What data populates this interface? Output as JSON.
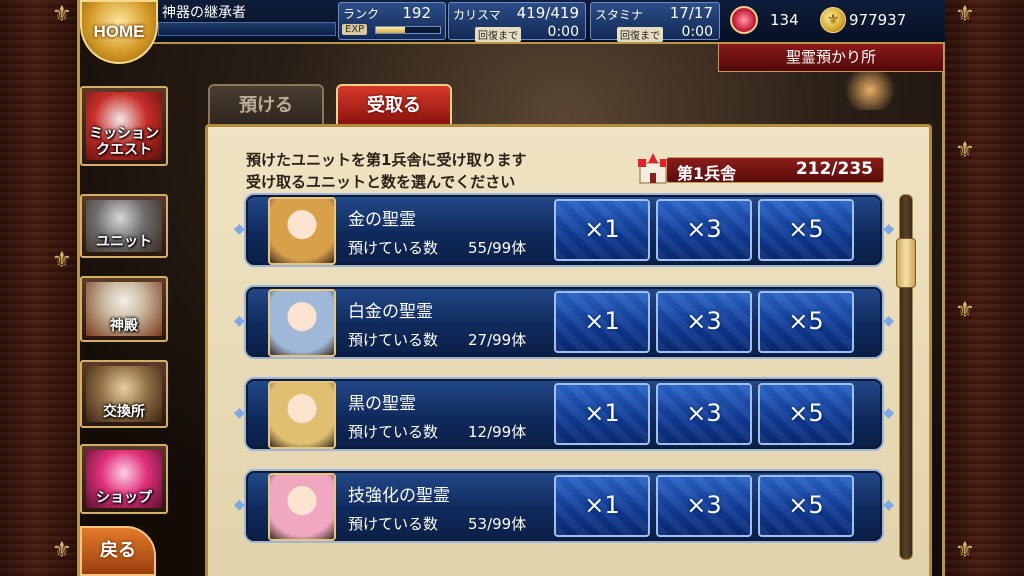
{
  "header": {
    "home_label": "HOME",
    "player_name": "神器の継承者",
    "rank_label": "ランク",
    "rank_value": "192",
    "exp_label": "EXP",
    "exp_progress": 0.45,
    "charisma_label": "カリスマ",
    "charisma_value": "419/419",
    "stamina_label": "スタミナ",
    "stamina_value": "17/17",
    "recovery_label": "回復まで",
    "charisma_recovery": "0:00",
    "stamina_recovery": "0:00",
    "gem_count": "134",
    "gold_count": "977937",
    "location": "聖霊預かり所"
  },
  "side_menu": {
    "items": [
      {
        "label": "ミッション\nクエスト",
        "icon": "crossed-swords-icon"
      },
      {
        "label": "ユニット",
        "icon": "armor-icon"
      },
      {
        "label": "神殿",
        "icon": "angel-icon"
      },
      {
        "label": "交換所",
        "icon": "scales-icon"
      },
      {
        "label": "ショップ",
        "icon": "crystal-icon"
      }
    ],
    "back_label": "戻る"
  },
  "tabs": {
    "deposit_label": "預ける",
    "receive_label": "受取る"
  },
  "panel": {
    "instruction_line1": "預けたユニットを第1兵舎に受け取ります",
    "instruction_line2": "受け取るユニットと数を選んでください",
    "barracks_label": "第1兵舎",
    "barracks_count": "212/235",
    "deposited_label": "預けている数",
    "quantity_buttons": [
      "×1",
      "×3",
      "×5"
    ],
    "units": [
      {
        "name": "金の聖霊",
        "count": "55/99体",
        "portrait_color": "#d9a04a"
      },
      {
        "name": "白金の聖霊",
        "count": "27/99体",
        "portrait_color": "#9fb8d8"
      },
      {
        "name": "黒の聖霊",
        "count": "12/99体",
        "portrait_color": "#e0c070"
      },
      {
        "name": "技強化の聖霊",
        "count": "53/99体",
        "portrait_color": "#f0a8c0"
      }
    ]
  },
  "colors": {
    "accent_gold": "#b8934a",
    "tab_active_red": "#d83a2a",
    "button_blue": "#2a64c8"
  }
}
